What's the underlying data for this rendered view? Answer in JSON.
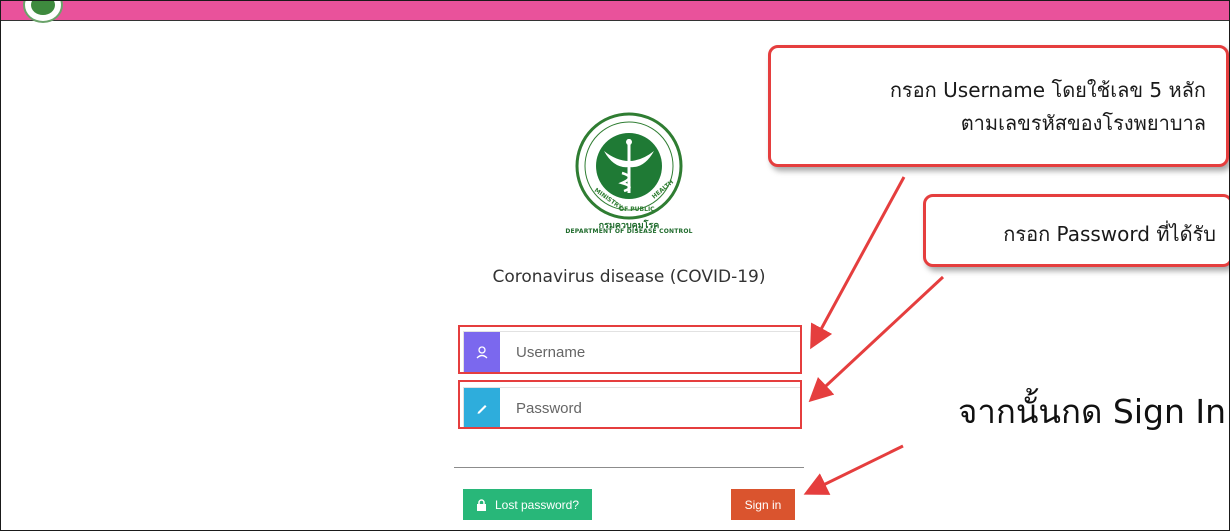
{
  "header": {
    "bar_color": "#e9529b"
  },
  "logo": {
    "thai_name": "กรมควบคุมโรค",
    "english_name": "DEPARTMENT OF DISEASE CONTROL"
  },
  "app_title": "Coronavirus disease (COVID-19)",
  "form": {
    "username_placeholder": "Username",
    "password_placeholder": "Password",
    "username_icon": "user-icon",
    "password_icon": "pencil-icon",
    "username_icon_color": "#7b68ee",
    "password_icon_color": "#2eaddc"
  },
  "buttons": {
    "lost_password": "Lost password?",
    "sign_in": "Sign in",
    "lost_color": "#28b779",
    "sign_color": "#da542e"
  },
  "callouts": {
    "username_line1": "กรอก Username โดยใช้เลข 5 หลัก",
    "username_line2": "ตามเลขรหัสของโรงพยาบาล",
    "password": "กรอก Password ที่ได้รับ",
    "signin": "จากนั้นกด Sign In"
  },
  "annotation_color": "#e53e3e"
}
